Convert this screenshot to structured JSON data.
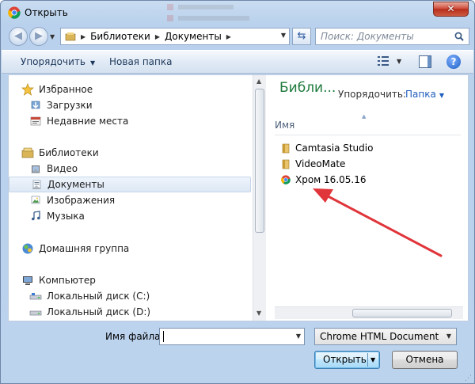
{
  "window": {
    "title": "Открыть",
    "close_label": "✕"
  },
  "address_bar": {
    "segments": [
      "Библиотеки",
      "Документы"
    ],
    "search_placeholder": "Поиск: Документы"
  },
  "toolbar": {
    "organize_label": "Упорядочить",
    "new_folder_label": "Новая папка",
    "help_label": "?"
  },
  "nav_pane": {
    "favorites": {
      "label": "Избранное",
      "items": [
        "Загрузки",
        "Недавние места"
      ]
    },
    "libraries": {
      "label": "Библиотеки",
      "items": [
        "Видео",
        "Документы",
        "Изображения",
        "Музыка"
      ],
      "selected": "Документы"
    },
    "homegroup": {
      "label": "Домашняя группа"
    },
    "computer": {
      "label": "Компьютер",
      "items": [
        "Локальный диск (C:)",
        "Локальный диск (D:)"
      ]
    }
  },
  "content": {
    "title": "Библи...",
    "arrange_label": "Упорядочить:",
    "arrange_value": "Папка",
    "column_name": "Имя",
    "files": [
      {
        "name": "Camtasia Studio",
        "icon": "folder-icon"
      },
      {
        "name": "VideoMate",
        "icon": "folder-icon"
      },
      {
        "name": "Хром 16.05.16",
        "icon": "chrome-icon"
      }
    ]
  },
  "footer": {
    "filename_label": "Имя файла:",
    "filename_value": "",
    "filetype_value": "Chrome HTML Document",
    "open_label": "Открыть",
    "cancel_label": "Отмена"
  },
  "colors": {
    "library_title": "#1e7a3c",
    "annotation_arrow": "#e0353a",
    "close_button": "#c8412d"
  }
}
